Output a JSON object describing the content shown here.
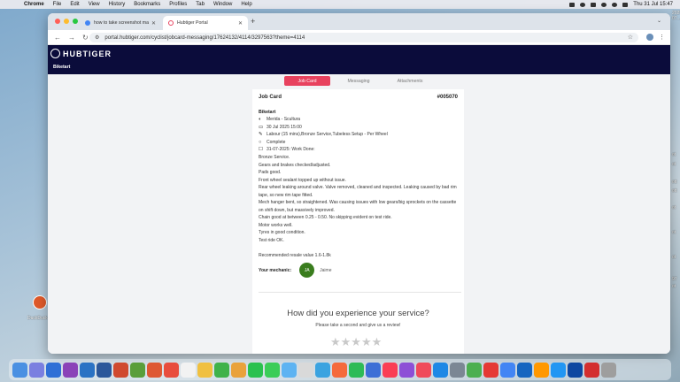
{
  "menubar": {
    "app": "Chrome",
    "items": [
      "File",
      "Edit",
      "View",
      "History",
      "Bookmarks",
      "Profiles",
      "Tab",
      "Window",
      "Help"
    ],
    "clock": "Thu 31 Jul  15:47"
  },
  "desktop": {
    "labels": [
      "2025-\n07...",
      "ot",
      "ot",
      "ott",
      "ott",
      "ot",
      "ot",
      "ot",
      "97",
      "ot",
      "DuckDuck"
    ]
  },
  "browser": {
    "tabs": [
      {
        "title": "how to take screenshot mac"
      },
      {
        "title": "Hubtiger Portal"
      }
    ],
    "url": "portal.hubtiger.com/cyclist/jobcard-messaging/17624132/4114/3297563?theme=4114"
  },
  "app": {
    "logo": "HUBTIGER",
    "org": "Biketart",
    "subtabs": [
      "Job Card",
      "Messaging",
      "Attachments"
    ],
    "active_tab": "Job Card",
    "accent": "#e8425e",
    "header_bg": "#0b0c3b"
  },
  "jobcard": {
    "title": "Job Card",
    "number": "#005070",
    "shop": "Biketart",
    "bike": "Merida - Scultura",
    "date": "30 Jul 2025 15:00",
    "services": "Labour (15 mins),Bronze Service,Tubeless Setup - Per Wheel",
    "status": "Complete",
    "work_done": "31-07-2025: Work Done:",
    "notes": [
      "Bronze Service.",
      "Gears and brakes checked/adjusted.",
      "Pads good.",
      "Front wheel sealant topped up without issue.",
      "Rear wheel leaking around valve. Valve removed, cleaned and inspected. Leaking caused by bad rim tape, so new rim tape fitted.",
      "Mech hanger bent, so straightened. Was causing issues with low gears/big sprockets on the cassette on shift down, but massively improved.",
      "Chain good at between 0.25 - 0.50. No skipping evident on test ride.",
      "Motor works well.",
      "Tyres in good condition.",
      "Test ride OK.",
      "",
      "Recommended resale value 1.6-1.8k"
    ],
    "mechanic_label": "Your mechanic:",
    "mechanic_initials": "JA",
    "mechanic_name": "Jaime"
  },
  "review": {
    "title": "How did you experience your service?",
    "subtitle": "Please take a second and give us a review!",
    "stars": "★★★★★"
  }
}
